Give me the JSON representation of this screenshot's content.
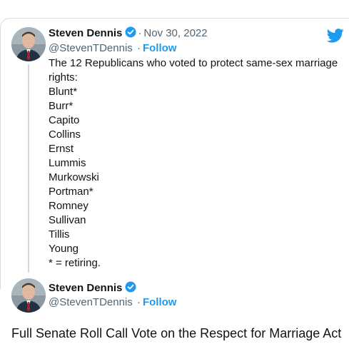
{
  "tweet": {
    "author_name": "Steven Dennis",
    "handle": "@StevenTDennis",
    "separator": "·",
    "date": "Nov 30, 2022",
    "follow_label": "Follow",
    "verified_icon": "verified-badge-icon",
    "platform_icon": "twitter-bird-icon",
    "lines": [
      "The 12 Republicans who voted to protect same-sex marriage",
      "rights:",
      "Blunt*",
      "Burr*",
      "Capito",
      "Collins",
      "Ernst",
      "Lummis",
      "Murkowski",
      "Portman*",
      "Romney",
      "Sullivan",
      "Tillis",
      "Young",
      "* = retiring."
    ]
  },
  "reply": {
    "author_name": "Steven Dennis",
    "handle": "@StevenTDennis",
    "separator": "·",
    "follow_label": "Follow",
    "verified_icon": "verified-badge-icon"
  },
  "quote": {
    "title": "Full Senate Roll Call Vote on the Respect for Marriage Act"
  },
  "colors": {
    "accent": "#1d9bf0",
    "text": "#0f1419",
    "muted": "#536471",
    "thread_line": "#cfd9de"
  }
}
